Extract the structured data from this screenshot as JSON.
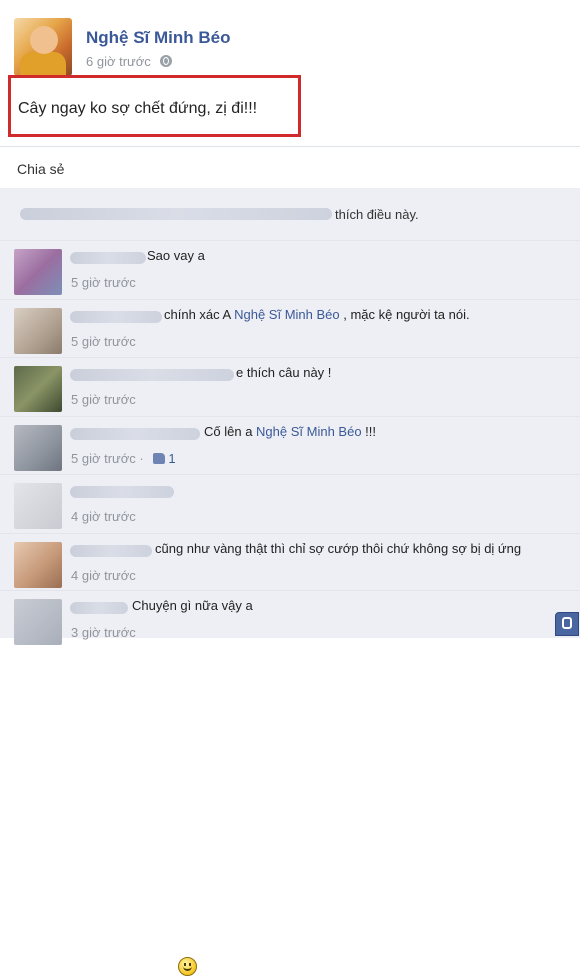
{
  "post": {
    "author": "Nghệ Sĩ Minh Béo",
    "time": "6 giờ trước",
    "status": "Cây ngay ko sợ chết đứng, zị đi!!!",
    "share_label": "Chia sẻ"
  },
  "likes": {
    "text": "thích điều này."
  },
  "comments": [
    {
      "text": "Sao vay a",
      "time": "5 giờ trước"
    },
    {
      "text_before": "chính xác A ",
      "link": "Nghệ Sĩ Minh Béo",
      "text_after": " , mặc kệ người ta nói.",
      "time": "5 giờ trước"
    },
    {
      "text": "e thích câu này !",
      "time": "5 giờ trước"
    },
    {
      "text_before": "Cố lên a ",
      "link": "Nghệ Sĩ Minh Béo",
      "text_after": " !!!",
      "time": "5 giờ trước",
      "like_count": "1"
    },
    {
      "text": "",
      "time": "4 giờ trước",
      "emoticon": "smiley-icon"
    },
    {
      "text": "cũng như vàng thật thì chỉ sợ cướp thôi chứ không sợ bị dị ứng",
      "time": "4 giờ trước"
    },
    {
      "text": "Chuyện gì nữa vậy a",
      "time": "3 giờ trước"
    }
  ],
  "colors": {
    "link": "#3b5998",
    "highlight": "#d12a2a",
    "feedback_bg": "#edeff4"
  }
}
